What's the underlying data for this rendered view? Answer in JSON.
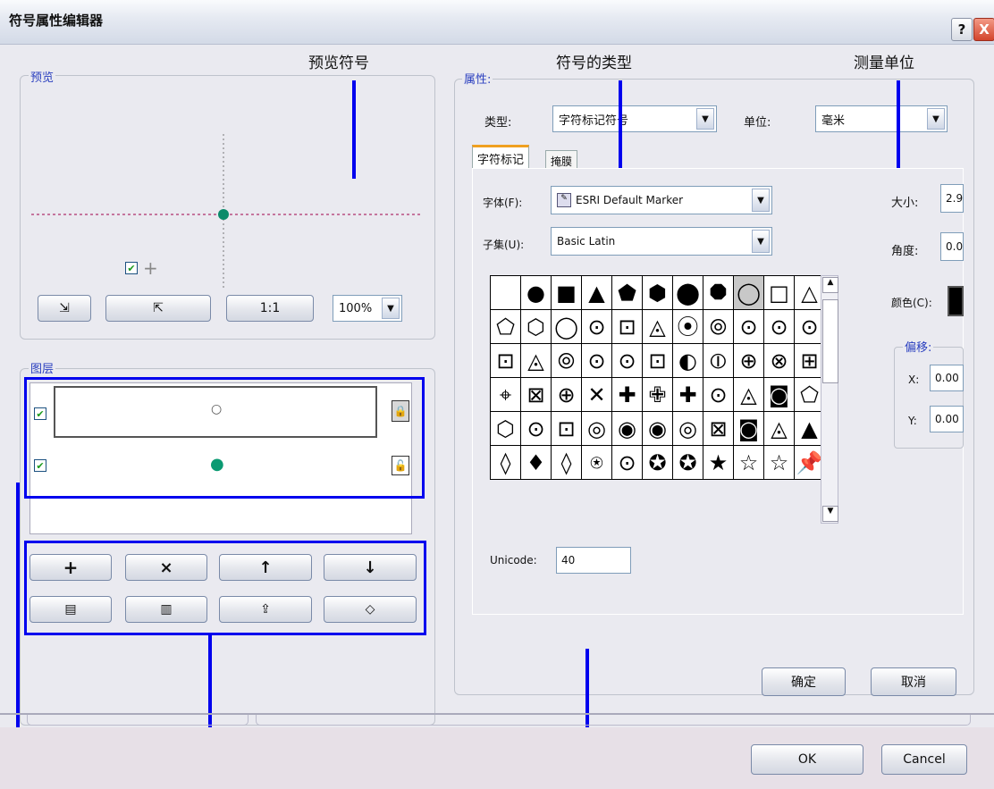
{
  "window": {
    "title": "符号属性编辑器",
    "help_label": "?",
    "close_label": "X"
  },
  "annotations": {
    "preview_symbol": "预览符号",
    "symbol_type": "符号的类型",
    "measure_unit": "测量单位"
  },
  "preview": {
    "group_label": "预览",
    "zoom_value": "100%",
    "buttons": [
      "⇲",
      "⇱",
      "1:1"
    ]
  },
  "layers": {
    "group_label": "图层",
    "items": [
      {
        "symbol": "○",
        "lock": "🔒"
      },
      {
        "symbol": "●",
        "lock": "🔓"
      }
    ],
    "buttons_row1": [
      "+",
      "×",
      "↑",
      "↓"
    ],
    "buttons_row2": [
      "▤",
      "▥",
      "⇪",
      "◇"
    ]
  },
  "properties": {
    "group_label": "属性:",
    "type_label": "类型:",
    "type_value": "字符标记符号",
    "unit_label": "单位:",
    "unit_value": "毫米",
    "tabs": [
      "字符标记",
      "掩膜"
    ],
    "font_label": "字体(F):",
    "font_value": "ESRI Default Marker",
    "subset_label": "子集(U):",
    "subset_value": "Basic Latin",
    "size_label": "大小:",
    "size_value": "2.9",
    "angle_label": "角度:",
    "angle_value": "0.0",
    "color_label": "颜色(C):",
    "offset_label": "偏移:",
    "x_label": "X:",
    "x_value": "0.00",
    "y_label": "Y:",
    "y_value": "0.00",
    "unicode_label": "Unicode:",
    "unicode_value": "40",
    "glyphs": [
      "",
      "●",
      "■",
      "▲",
      "⬟",
      "⬢",
      "⬤",
      "⯃",
      "◯",
      "□",
      "△",
      "⬠",
      "⬡",
      "◯",
      "⊙",
      "⊡",
      "◬",
      "⦿",
      "⦾",
      "⊙",
      "⊙",
      "⊙",
      "⊡",
      "◬",
      "⦾",
      "⊙",
      "⊙",
      "⊡",
      "◐",
      "⦶",
      "⊕",
      "⊗",
      "⊞",
      "⌖",
      "⊠",
      "⊕",
      "✕",
      "✚",
      "✙",
      "✚",
      "⊙",
      "◬",
      "◙",
      "⬠",
      "⬡",
      "⊙",
      "⊡",
      "◎",
      "◉",
      "◉",
      "◎",
      "⊠",
      "◙",
      "◬",
      "▲",
      "◊",
      "♦",
      "◊",
      "⍟",
      "⊙",
      "✪",
      "✪",
      "★",
      "☆",
      "☆",
      "📌"
    ]
  },
  "dialog_buttons": {
    "ok_cn": "确定",
    "cancel_cn": "取消",
    "ok": "OK",
    "cancel": "Cancel"
  }
}
